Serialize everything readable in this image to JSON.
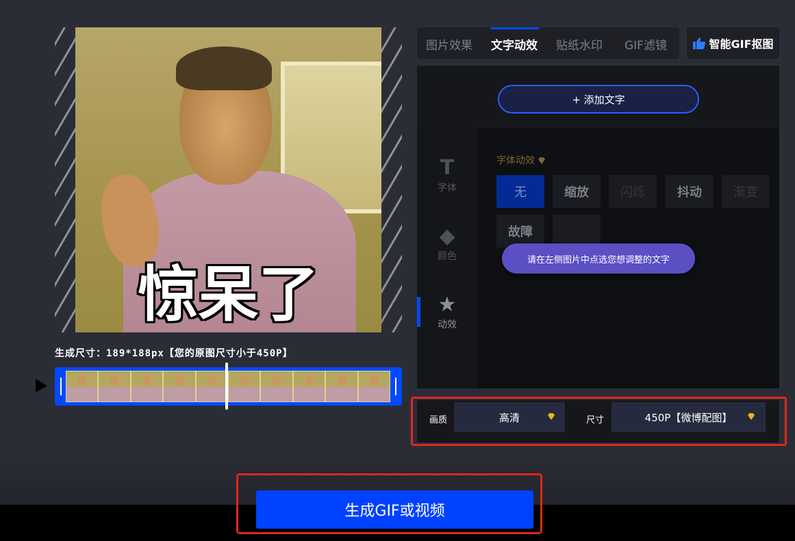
{
  "preview": {
    "caption": "惊呆了",
    "size_info": "生成尺寸：189*188px【您的原图尺寸小于450P】",
    "frame_count": 10
  },
  "tabs": [
    {
      "label": "图片效果",
      "active": false
    },
    {
      "label": "文字动效",
      "active": true
    },
    {
      "label": "贴纸水印",
      "active": false
    },
    {
      "label": "GIF滤镜",
      "active": false
    }
  ],
  "smart_button": {
    "label": "智能GIF抠图",
    "icon": "thumbs-up-icon"
  },
  "add_text": {
    "label": "+ 添加文字"
  },
  "side_nav": [
    {
      "label": "字体",
      "icon": "font-icon",
      "glyph": "T"
    },
    {
      "label": "颜色",
      "icon": "paint-bucket-icon",
      "glyph": "◆"
    },
    {
      "label": "动效",
      "icon": "star-list-icon",
      "glyph": "★"
    }
  ],
  "font_effects": {
    "label": "字体动效",
    "options": [
      "无",
      "缩放",
      "闪烁",
      "抖动",
      "渐变",
      "故障",
      ""
    ]
  },
  "tooltip": "请在左侧图片中点选您想调整的文字",
  "quality": {
    "label": "画质",
    "value": "高清",
    "size_label": "尺寸",
    "size_value": "450P【微博配图】"
  },
  "generate": {
    "label": "生成GIF或视频"
  },
  "colors": {
    "accent": "#0042ff",
    "highlight_box": "#e0261d",
    "tooltip": "#5b4fc4",
    "gem": "#e8b51c"
  }
}
